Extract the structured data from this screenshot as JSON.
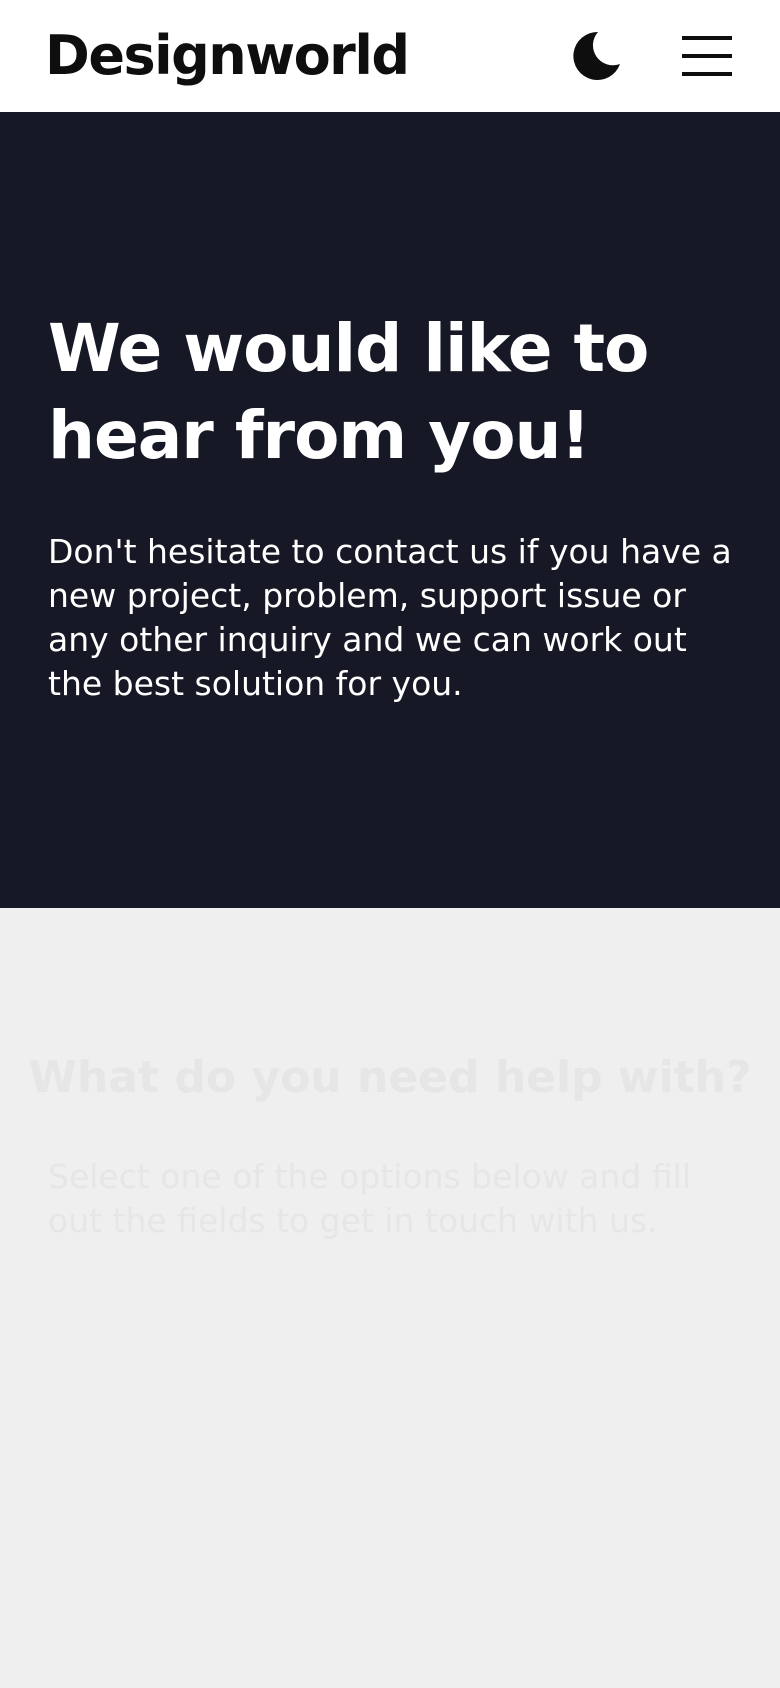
{
  "header": {
    "logo": "Designworld",
    "theme_toggle_icon": "moon-icon",
    "menu_icon": "hamburger-menu-icon"
  },
  "hero": {
    "title": "We would like to hear from you!",
    "description": "Don't hesitate to contact us if you have a new project, problem, support issue or any other inquiry and we can work out the best solution for you."
  },
  "help": {
    "title": "What do you need help with?",
    "description": "Select one of the options below and fill out the fields to get in touch with us."
  },
  "colors": {
    "header_bg": "#ffffff",
    "hero_bg": "#161925",
    "page_bg": "#efefef",
    "faded_text": "#e6e6e6",
    "text_dark": "#0e0e0e"
  }
}
